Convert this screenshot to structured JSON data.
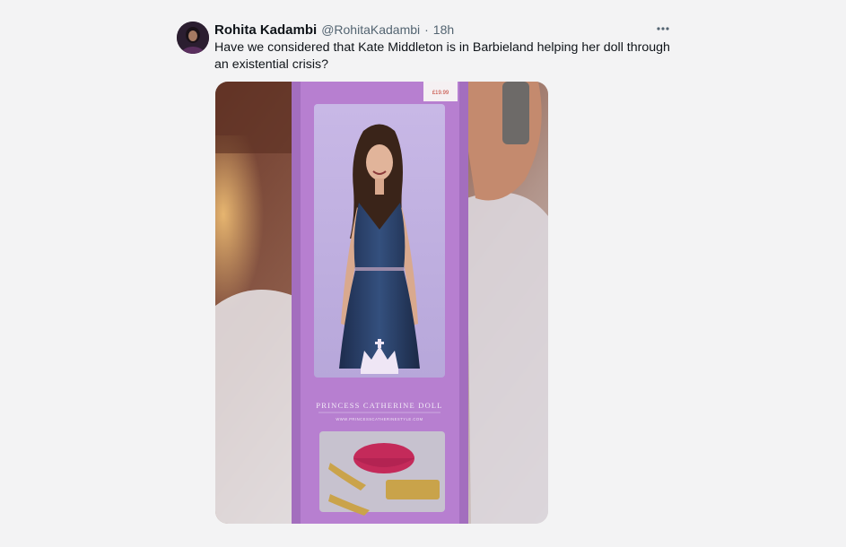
{
  "tweet": {
    "author_name": "Rohita Kadambi",
    "author_handle": "@RohitaKadambi",
    "separator": "·",
    "timestamp": "18h",
    "text": "Have we considered that Kate Middleton is in Barbieland helping her doll through an existential crisis?",
    "more_icon": "more-horizontal-icon"
  },
  "media": {
    "box_title": "PRINCESS CATHERINE DOLL",
    "box_url": "WWW.PRINCESSCATHERINESTYLE.COM",
    "price_tag": "£19.99",
    "colors": {
      "box_purple": "#b77fd0",
      "dress_navy": "#2a3e66",
      "clutch_pink": "#c42a5a",
      "shoe_gold": "#c9a34a"
    }
  }
}
